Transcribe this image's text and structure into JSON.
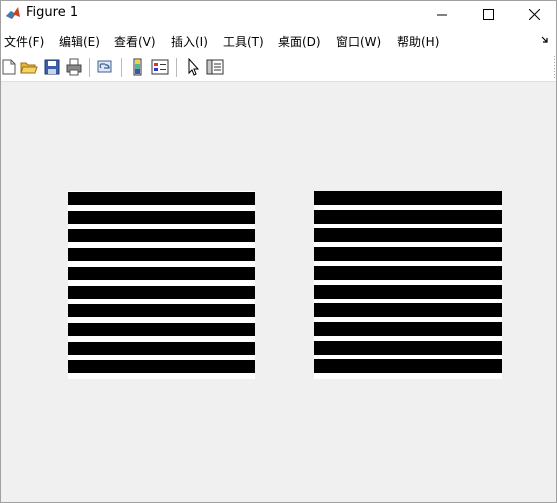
{
  "window": {
    "title": "Figure 1",
    "minimize_icon": "minimize-icon",
    "maximize_icon": "maximize-icon",
    "close_icon": "close-icon"
  },
  "menu": {
    "items": [
      {
        "label": "文件(F)"
      },
      {
        "label": "编辑(E)"
      },
      {
        "label": "查看(V)"
      },
      {
        "label": "插入(I)"
      },
      {
        "label": "工具(T)"
      },
      {
        "label": "桌面(D)"
      },
      {
        "label": "窗口(W)"
      },
      {
        "label": "帮助(H)"
      }
    ],
    "overflow_icon": "dock-arrow-icon"
  },
  "toolbar": {
    "buttons": [
      "new-figure-icon",
      "open-file-icon",
      "save-icon",
      "print-icon",
      "link-figure-icon",
      "insert-colorbar-icon",
      "insert-legend-icon",
      "edit-plot-icon",
      "property-editor-icon"
    ]
  },
  "figure": {
    "background": "#f0f0f0",
    "images": [
      {
        "stripe_color": "#000000",
        "background": "#ffffff",
        "stripe_count": 10
      },
      {
        "stripe_color": "#000000",
        "background": "#ffffff",
        "stripe_count": 10
      }
    ]
  }
}
